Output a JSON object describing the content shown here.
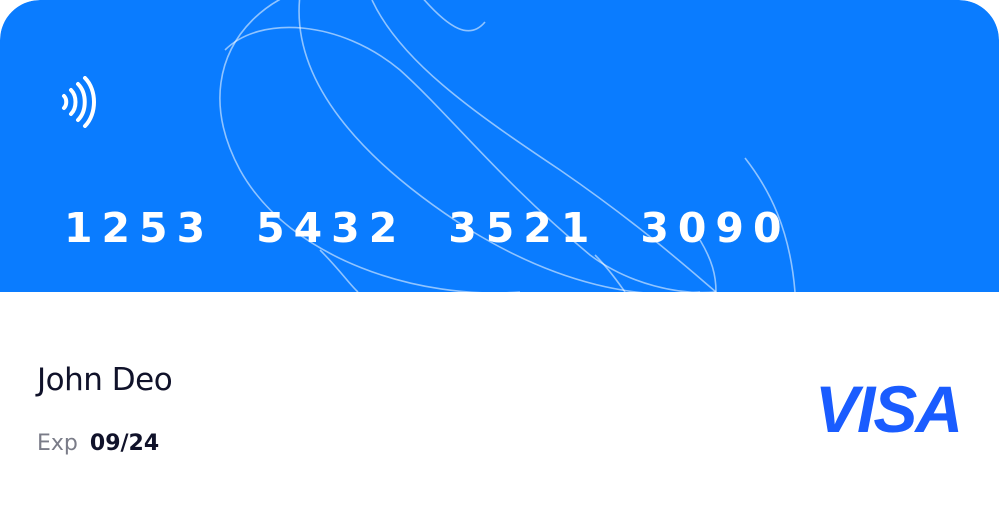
{
  "card": {
    "number_groups": [
      "1253",
      "5432",
      "3521",
      "3090"
    ],
    "holder_name": "John Deo",
    "expiry_label": "Exp",
    "expiry_value": "09/24",
    "brand": "VISA",
    "icons": {
      "contactless": "contactless-icon",
      "brand_logo": "visa-logo-icon"
    },
    "colors": {
      "card_top": "#0a7cff",
      "brand_logo": "#1a5cff",
      "text_dark": "#10122a",
      "text_muted": "#7a7c88"
    }
  }
}
